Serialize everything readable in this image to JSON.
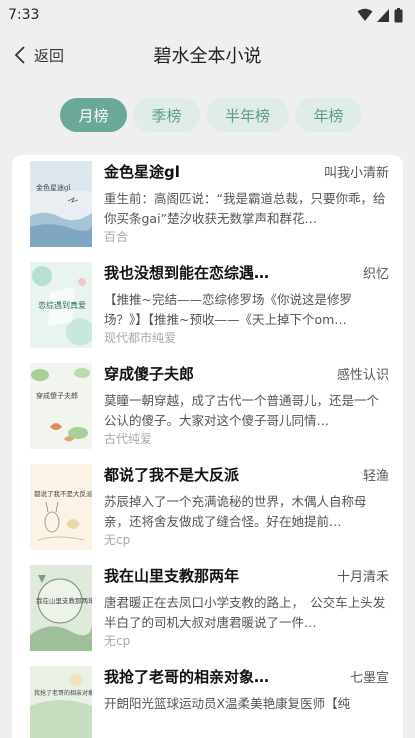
{
  "status": {
    "time": "7:33"
  },
  "header": {
    "back_label": "返回",
    "title": "碧水全本小说"
  },
  "tabs": [
    {
      "label": "月榜",
      "active": true
    },
    {
      "label": "季榜",
      "active": false
    },
    {
      "label": "半年榜",
      "active": false
    },
    {
      "label": "年榜",
      "active": false
    }
  ],
  "colors": {
    "accent": "#6aa898",
    "tab_bg": "#e0ece8",
    "tab_text": "#5b9d8c"
  },
  "books": [
    {
      "title": "金色星途gl",
      "author": "叫我小清新",
      "desc": "重生前：高阁匹说：“我是霸道总裁，只要你乖，给你买条gai”楚汐收获无数掌声和群花…",
      "tag": "百合",
      "cover_text": "金色星途gl"
    },
    {
      "title": "我也没想到能在恋综遇…",
      "author": "织忆",
      "desc": "【推推~完结——恋综修罗场《你说这是修罗场？》】【推推~预收——《天上掉下个om…",
      "tag": "现代都市纯爱",
      "cover_text": "恋综遇到真爱"
    },
    {
      "title": "穿成傻子夫郎",
      "author": "感性认识",
      "desc": "莫瞳一朝穿越，成了古代一个普通哥儿，还是一个公认的傻子。大家对这个傻子哥儿同情…",
      "tag": "古代纯爱",
      "cover_text": "穿成傻子夫郎"
    },
    {
      "title": "都说了我不是大反派",
      "author": "轻渔",
      "desc": "苏辰掉入了一个充满诡秘的世界，木偶人自称母亲，还将舍友做成了缝合怪。好在她提前…",
      "tag": "无cp",
      "cover_text": "都说了我不是大反派"
    },
    {
      "title": "我在山里支教那两年",
      "author": "十月清禾",
      "desc": "唐君暖正在去凤口小学支教的路上，　公交车上头发半白了的司机大叔对唐君暖说了一件…",
      "tag": "无cp",
      "cover_text": "我在山里支教那两年"
    },
    {
      "title": "我抢了老哥的相亲对象…",
      "author": "七墨宣",
      "desc": "开朗阳光篮球运动员X温柔美艳康复医师【纯",
      "tag": "",
      "cover_text": "我抢了老哥的相亲对象"
    }
  ]
}
